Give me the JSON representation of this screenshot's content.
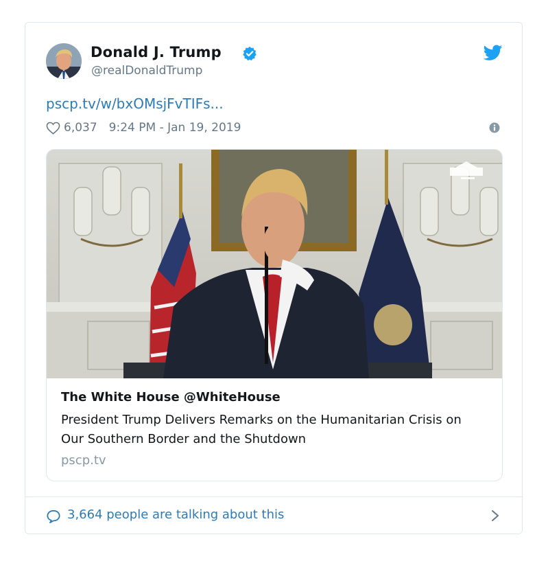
{
  "tweet": {
    "display_name": "Donald J. Trump",
    "handle": "@realDonaldTrump",
    "link_text": "pscp.tv/w/bxOMsjFvTIFs...",
    "like_count": "6,037",
    "timestamp": "9:24 PM - Jan 19, 2019",
    "icons": {
      "avatar": "avatar",
      "verified": "verified-badge-icon",
      "brand": "twitter-bird-icon",
      "like": "heart-icon",
      "info": "info-icon",
      "reply": "speech-bubble-icon",
      "more": "chevron-right-icon"
    },
    "colors": {
      "brand_blue": "#1da1f2",
      "link_blue": "#2b7bb9",
      "secondary_text": "#657786",
      "border": "#e1e8ed"
    }
  },
  "media_card": {
    "source": "The White House @WhiteHouse",
    "description": "President Trump Delivers Remarks on the Humanitarian Crisis on Our Southern Border and the Shutdown",
    "domain": "pscp.tv",
    "image_subject": "video-still-president-at-podium"
  },
  "footer": {
    "talking_text": "3,664 people are talking about this"
  }
}
